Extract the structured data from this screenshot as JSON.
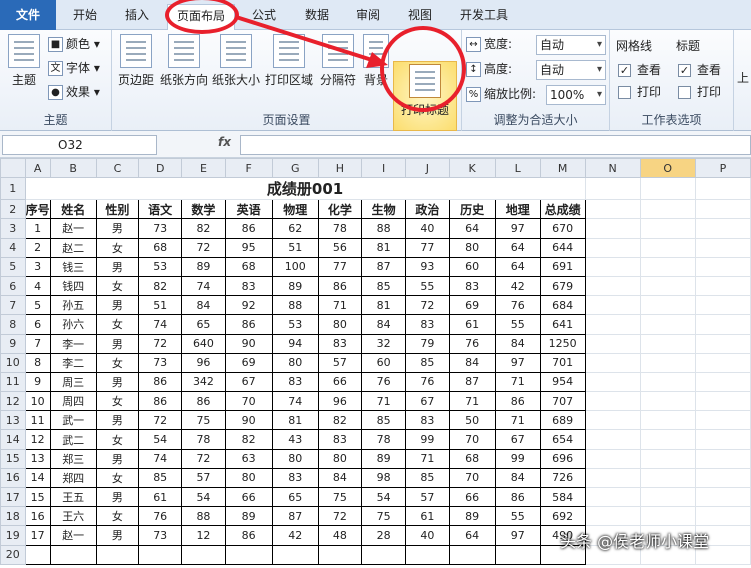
{
  "tabs": [
    "文件",
    "开始",
    "插入",
    "页面布局",
    "公式",
    "数据",
    "审阅",
    "视图",
    "开发工具"
  ],
  "ribbon": {
    "themes": {
      "big": "主题",
      "colors": "颜色",
      "fonts": "字体",
      "effects": "效果",
      "label": "主题"
    },
    "page_setup": {
      "margins": "页边距",
      "orientation": "纸张方向",
      "size": "纸张大小",
      "print_area": "打印区域",
      "breaks": "分隔符",
      "background": "背景",
      "print_titles": "打印标题",
      "label": "页面设置"
    },
    "scale": {
      "width_label": "宽度:",
      "width_val": "自动",
      "height_label": "高度:",
      "height_val": "自动",
      "scale_label": "缩放比例:",
      "scale_val": "100%",
      "label": "调整为合适大小"
    },
    "sheet_opts": {
      "gridlines": "网格线",
      "headings": "标题",
      "view": "查看",
      "print": "打印",
      "label": "工作表选项"
    },
    "more": "上"
  },
  "namebox": "O32",
  "fx": "fx",
  "columns": [
    "A",
    "B",
    "C",
    "D",
    "E",
    "F",
    "G",
    "H",
    "I",
    "J",
    "K",
    "L",
    "M",
    "N",
    "O",
    "P"
  ],
  "selected_col": "O",
  "title": "成绩册001",
  "headers": [
    "序号",
    "姓名",
    "性别",
    "语文",
    "数学",
    "英语",
    "物理",
    "化学",
    "生物",
    "政治",
    "历史",
    "地理",
    "总成绩"
  ],
  "rows": [
    [
      "1",
      "赵一",
      "男",
      "73",
      "82",
      "86",
      "62",
      "78",
      "88",
      "40",
      "64",
      "97",
      "670"
    ],
    [
      "2",
      "赵二",
      "女",
      "68",
      "72",
      "95",
      "51",
      "56",
      "81",
      "77",
      "80",
      "64",
      "644"
    ],
    [
      "3",
      "钱三",
      "男",
      "53",
      "89",
      "68",
      "100",
      "77",
      "87",
      "93",
      "60",
      "64",
      "691"
    ],
    [
      "4",
      "钱四",
      "女",
      "82",
      "74",
      "83",
      "89",
      "86",
      "85",
      "55",
      "83",
      "42",
      "679"
    ],
    [
      "5",
      "孙五",
      "男",
      "51",
      "84",
      "92",
      "88",
      "71",
      "81",
      "72",
      "69",
      "76",
      "684"
    ],
    [
      "6",
      "孙六",
      "女",
      "74",
      "65",
      "86",
      "53",
      "80",
      "84",
      "83",
      "61",
      "55",
      "641"
    ],
    [
      "7",
      "李一",
      "男",
      "72",
      "640",
      "90",
      "94",
      "83",
      "32",
      "79",
      "76",
      "84",
      "1250"
    ],
    [
      "8",
      "李二",
      "女",
      "73",
      "96",
      "69",
      "80",
      "57",
      "60",
      "85",
      "84",
      "97",
      "701"
    ],
    [
      "9",
      "周三",
      "男",
      "86",
      "342",
      "67",
      "83",
      "66",
      "76",
      "76",
      "87",
      "71",
      "954"
    ],
    [
      "10",
      "周四",
      "女",
      "86",
      "86",
      "70",
      "74",
      "96",
      "71",
      "67",
      "71",
      "86",
      "707"
    ],
    [
      "11",
      "武一",
      "男",
      "72",
      "75",
      "90",
      "81",
      "82",
      "85",
      "83",
      "50",
      "71",
      "689"
    ],
    [
      "12",
      "武二",
      "女",
      "54",
      "78",
      "82",
      "43",
      "83",
      "78",
      "99",
      "70",
      "67",
      "654"
    ],
    [
      "13",
      "郑三",
      "男",
      "74",
      "72",
      "63",
      "80",
      "80",
      "89",
      "71",
      "68",
      "99",
      "696"
    ],
    [
      "14",
      "郑四",
      "女",
      "85",
      "57",
      "80",
      "83",
      "84",
      "98",
      "85",
      "70",
      "84",
      "726"
    ],
    [
      "15",
      "王五",
      "男",
      "61",
      "54",
      "66",
      "65",
      "75",
      "54",
      "57",
      "66",
      "86",
      "584"
    ],
    [
      "16",
      "王六",
      "女",
      "76",
      "88",
      "89",
      "87",
      "72",
      "75",
      "61",
      "89",
      "55",
      "692"
    ],
    [
      "17",
      "赵一",
      "男",
      "73",
      "12",
      "86",
      "42",
      "48",
      "28",
      "40",
      "64",
      "97",
      "490"
    ]
  ],
  "row_numbers": [
    "1",
    "2",
    "3",
    "4",
    "5",
    "6",
    "7",
    "8",
    "9",
    "10",
    "11",
    "12",
    "13",
    "14",
    "15",
    "16",
    "17",
    "18",
    "19",
    "20"
  ],
  "watermark": "头条 @侯老师小课堂"
}
